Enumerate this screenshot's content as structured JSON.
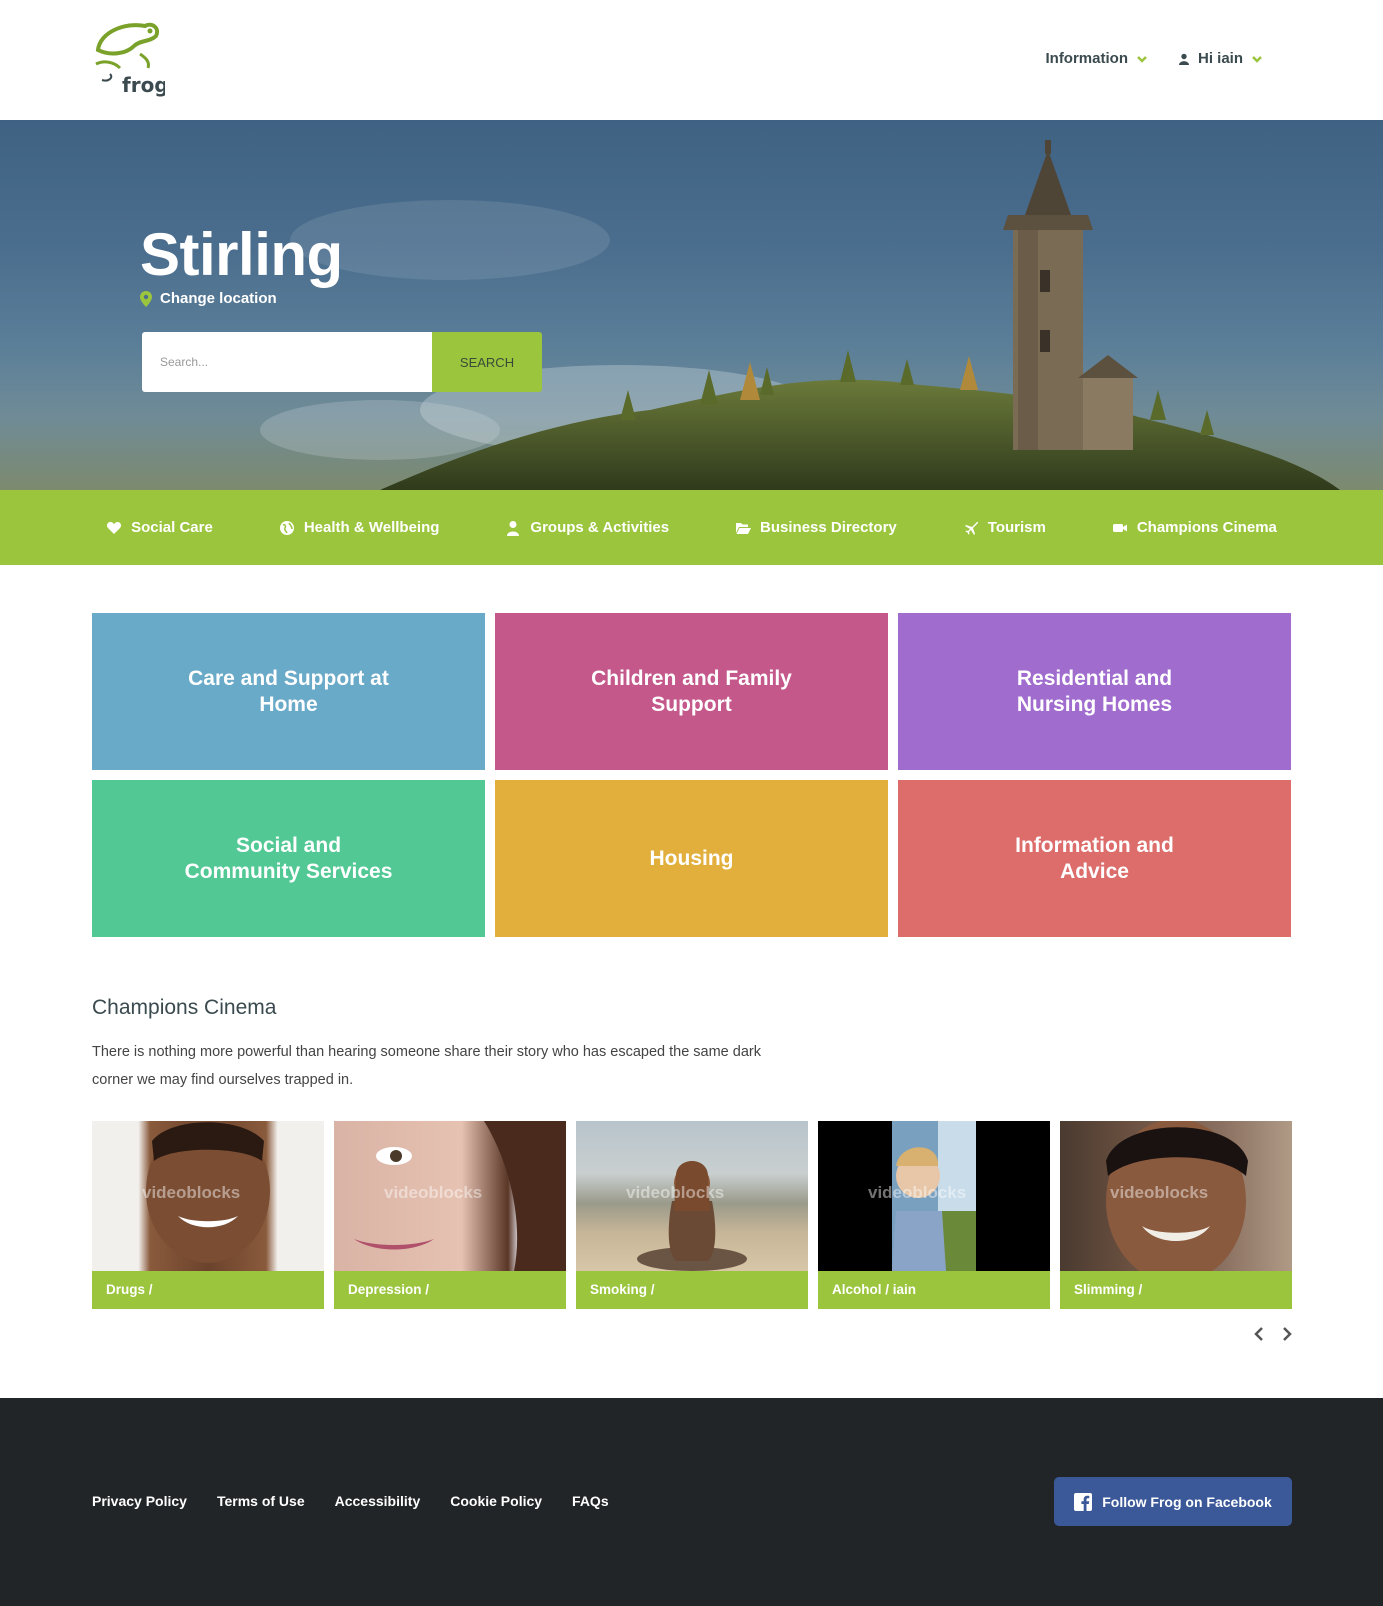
{
  "header": {
    "logo_text": "frog",
    "nav": [
      {
        "label": "Information"
      },
      {
        "label": "Hi iain"
      }
    ]
  },
  "hero": {
    "title": "Stirling",
    "change_location": "Change location",
    "search_placeholder": "Search...",
    "search_button": "SEARCH"
  },
  "categories": [
    {
      "label": "Social Care",
      "icon": "heart-icon"
    },
    {
      "label": "Health & Wellbeing",
      "icon": "globe-icon"
    },
    {
      "label": "Groups & Activities",
      "icon": "user-icon"
    },
    {
      "label": "Business Directory",
      "icon": "folder-open-icon"
    },
    {
      "label": "Tourism",
      "icon": "plane-icon"
    },
    {
      "label": "Champions Cinema",
      "icon": "video-camera-icon"
    }
  ],
  "tiles": [
    {
      "label": "Care and Support at Home",
      "color": "#6aaac9"
    },
    {
      "label": "Children and Family Support",
      "color": "#c4588a"
    },
    {
      "label": "Residential and Nursing Homes",
      "color": "#a06dcf"
    },
    {
      "label": "Social and Community Services",
      "color": "#52c995"
    },
    {
      "label": "Housing",
      "color": "#e2af3c"
    },
    {
      "label": "Information and Advice",
      "color": "#dc6d6b"
    }
  ],
  "cinema": {
    "title": "Champions Cinema",
    "description": "There is nothing more powerful than hearing someone share their story who has escaped the same dark corner we may find ourselves trapped in.",
    "videos": [
      {
        "label": "Drugs /"
      },
      {
        "label": "Depression /"
      },
      {
        "label": "Smoking /"
      },
      {
        "label": "Alcohol / iain"
      },
      {
        "label": "Slimming /"
      }
    ],
    "watermark": "videoblocks"
  },
  "footer": {
    "links": [
      "Privacy Policy",
      "Terms of Use",
      "Accessibility",
      "Cookie Policy",
      "FAQs"
    ],
    "facebook": "Follow Frog on Facebook"
  },
  "colors": {
    "accent": "#9bc53d",
    "footer": "#212528",
    "facebook": "#3b5998"
  }
}
